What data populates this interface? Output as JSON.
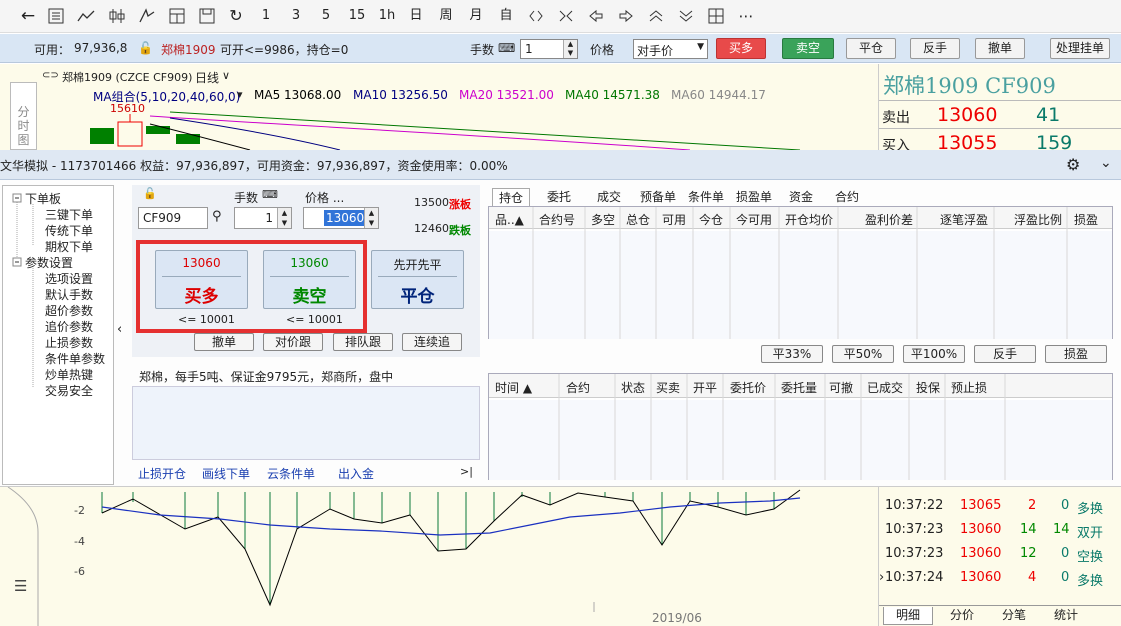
{
  "toolbar": {
    "numbers": [
      "1",
      "3",
      "5",
      "15",
      "1h",
      "日",
      "周",
      "月",
      "自"
    ]
  },
  "qbar": {
    "available_label": "可用：",
    "available_value": "97,936,8",
    "contract_name": "郑棉1909",
    "open_info": "可开<=9986，持仓=0",
    "qty_label": "手数",
    "qty_value": "1",
    "price_label": "价格",
    "price_mode": "对手价",
    "buy_long": "买多",
    "sell_short": "卖空",
    "close": "平仓",
    "reverse": "反手",
    "cancel": "撤单",
    "handle_orders": "处理挂单"
  },
  "chart": {
    "contract": "郑棉1909 (CZCE CF909)",
    "period": "日线",
    "side_label": [
      "分",
      "时",
      "图"
    ],
    "ma_group": "MA组合(5,10,20,40,60,0)",
    "ma5": "MA5 13068.00",
    "ma10": "MA10 13256.50",
    "ma20": "MA20 13521.00",
    "ma40": "MA40 14571.38",
    "ma60": "MA60 14944.17",
    "price_tag": "15610",
    "colors": {
      "ma5": "#000000",
      "ma10": "#000080",
      "ma20": "#cc00cc",
      "ma40": "#007700",
      "ma60": "#888888"
    }
  },
  "quote": {
    "title": "郑棉1909  CF909",
    "ask_label": "卖出",
    "ask_price": "13060",
    "ask_vol": "41",
    "bid_label": "买入",
    "bid_price": "13055",
    "bid_vol": "159"
  },
  "dialog": {
    "header": "文华模拟 - 1173701466  权益：97,936,897，可用资金：97,936,897，资金使用率：0.00%",
    "tree": [
      {
        "label": "下单板",
        "level": 0
      },
      {
        "label": "三键下单",
        "level": 1
      },
      {
        "label": "传统下单",
        "level": 1
      },
      {
        "label": "期权下单",
        "level": 1
      },
      {
        "label": "参数设置",
        "level": 0
      },
      {
        "label": "选项设置",
        "level": 1
      },
      {
        "label": "默认手数",
        "level": 1
      },
      {
        "label": "超价参数",
        "level": 1
      },
      {
        "label": "追价参数",
        "level": 1
      },
      {
        "label": "止损参数",
        "level": 1
      },
      {
        "label": "条件单参数",
        "level": 1
      },
      {
        "label": "炒单热键",
        "level": 1
      },
      {
        "label": "交易安全",
        "level": 1
      }
    ],
    "order": {
      "qty_label": "手数",
      "price_label": "价格 ...",
      "symbol": "CF909",
      "qty": "1",
      "price": "13060",
      "limit_up_price": "13500",
      "limit_up_label": "涨板",
      "limit_down_price": "12460",
      "limit_down_label": "跌板",
      "buy_price": "13060",
      "buy_label": "买多",
      "buy_limit": "<= 10001",
      "sell_price": "13060",
      "sell_label": "卖空",
      "sell_limit": "<= 10001",
      "close_sub": "先开先平",
      "close_label": "平仓",
      "btn_cancel": "撤单",
      "btn_chase_counter": "对价跟",
      "btn_chase_queue": "排队跟",
      "btn_continuous": "连续追",
      "info": "郑棉，每手5吨、保证金9795元，郑商所，盘中",
      "links": [
        "止损开仓",
        "画线下单",
        "云条件单",
        "出入金"
      ],
      "more": ">|"
    },
    "tabs": [
      "持仓",
      "委托",
      "成交",
      "预备单",
      "条件单",
      "损盈单",
      "资金",
      "合约"
    ],
    "pos_cols": [
      "品..▲",
      "合约号",
      "多空",
      "总仓",
      "可用",
      "今仓",
      "今可用",
      "开仓均价",
      "盈利价差",
      "逐笔浮盈",
      "浮盈比例",
      "损盈"
    ],
    "pos_buttons": [
      "平33%",
      "平50%",
      "平100%",
      "反手",
      "损盈"
    ],
    "ord_cols": [
      "时间 ▲",
      "合约",
      "状态",
      "买卖",
      "开平",
      "委托价",
      "委托量",
      "可撤",
      "已成交",
      "投保",
      "预止损"
    ]
  },
  "lower": {
    "y_ticks": [
      "-2",
      "-4",
      "-6"
    ],
    "date": "2019/06"
  },
  "ticks": [
    {
      "time": "10:37:22",
      "price": "13065",
      "vol": "2",
      "oi": "0",
      "type": "多换"
    },
    {
      "time": "10:37:23",
      "price": "13060",
      "vol": "14",
      "oi": "14",
      "type": "双开"
    },
    {
      "time": "10:37:23",
      "price": "13060",
      "vol": "12",
      "oi": "0",
      "type": "空换"
    },
    {
      "time": "10:37:24",
      "price": "13060",
      "vol": "4",
      "oi": "0",
      "type": "多换"
    }
  ],
  "tick_tabs": [
    "明细",
    "分价",
    "分笔",
    "统计"
  ]
}
